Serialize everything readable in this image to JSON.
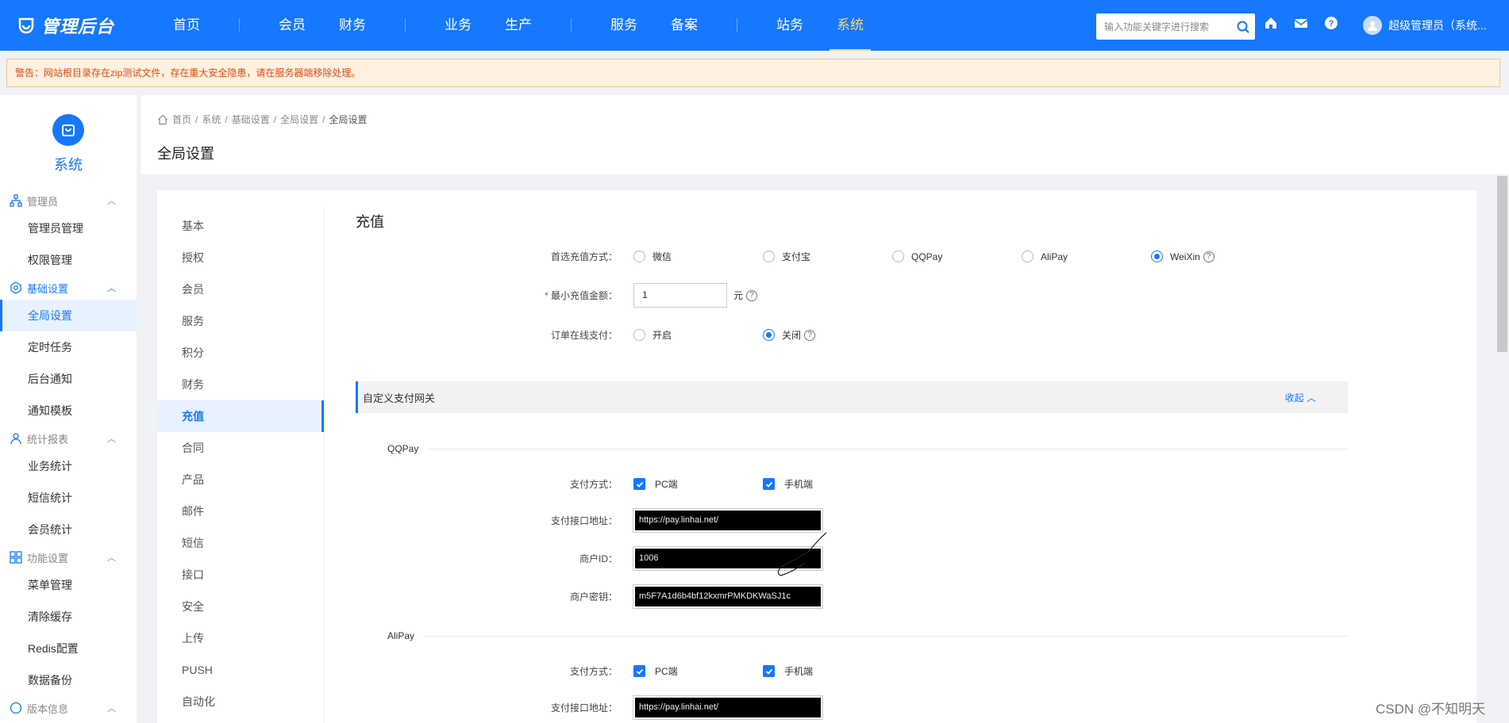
{
  "topbar": {
    "logo": "管理后台",
    "nav": [
      {
        "label": "首页"
      },
      {
        "label": "会员"
      },
      {
        "label": "财务"
      },
      {
        "label": "业务"
      },
      {
        "label": "生产"
      },
      {
        "label": "服务"
      },
      {
        "label": "备案"
      },
      {
        "label": "站务"
      },
      {
        "label": "系统",
        "active": true
      }
    ],
    "search_placeholder": "输入功能关键字进行搜索",
    "user": "超级管理员（系统..."
  },
  "warning": "警告：网站根目录存在zip测试文件，存在重大安全隐患，请在服务器端移除处理。",
  "sidebar": {
    "title": "系统",
    "groups": [
      {
        "label": "管理员",
        "items": [
          "管理员管理",
          "权限管理"
        ]
      },
      {
        "label": "基础设置",
        "items": [
          "全局设置",
          "定时任务",
          "后台通知",
          "通知模板"
        ]
      },
      {
        "label": "统计报表",
        "items": [
          "业务统计",
          "短信统计",
          "会员统计"
        ]
      },
      {
        "label": "功能设置",
        "items": [
          "菜单管理",
          "清除缓存",
          "Redis配置",
          "数据备份"
        ]
      },
      {
        "label": "版本信息",
        "items": []
      }
    ],
    "active_item": "全局设置"
  },
  "breadcrumb": [
    "首页",
    "系统",
    "基础设置",
    "全局设置",
    "全局设置"
  ],
  "page_title": "全局设置",
  "tabs": [
    "基本",
    "授权",
    "会员",
    "服务",
    "积分",
    "财务",
    "充值",
    "合同",
    "产品",
    "邮件",
    "短信",
    "接口",
    "安全",
    "上传",
    "PUSH",
    "自动化"
  ],
  "active_tab": "充值",
  "recharge": {
    "section_title": "充值",
    "preferred_label": "首选充值方式：",
    "preferred_options": [
      "微信",
      "支付宝",
      "QQPay",
      "AliPay",
      "WeiXin"
    ],
    "preferred_selected": "WeiXin",
    "min_label": "最小充值金额：",
    "min_value": "1",
    "min_unit": "元",
    "order_label": "订单在线支付：",
    "order_options": [
      "开启",
      "关闭"
    ],
    "order_selected": "关闭",
    "panel_title": "自定义支付网关",
    "panel_toggle": "收起",
    "gateways": [
      {
        "name": "QQPay",
        "method_label": "支付方式：",
        "methods": [
          "PC端",
          "手机端"
        ],
        "url_label": "支付接口地址：",
        "url": "https://pay.linhai.net/",
        "merchant_label": "商户ID：",
        "merchant": "1006",
        "key_label": "商户密钥：",
        "key": "m5F7A1d6b4bf12kxmrPMKDKWaSJ1c"
      },
      {
        "name": "AliPay",
        "method_label": "支付方式：",
        "methods": [
          "PC端",
          "手机端"
        ],
        "url_label": "支付接口地址：",
        "url": "https://pay.linhai.net/"
      }
    ]
  },
  "watermark": "CSDN @不知明天",
  "colors": {
    "primary": "#1677ff",
    "active_nav": "#ffd666",
    "warning_text": "#e04a12",
    "warning_bg": "#fff1e0"
  }
}
